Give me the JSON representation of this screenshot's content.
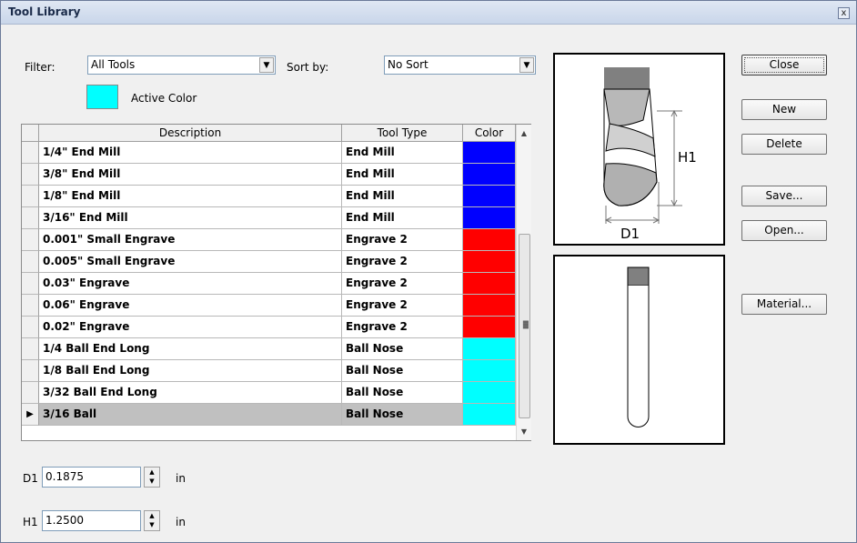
{
  "window": {
    "title": "Tool Library",
    "close_glyph": "x"
  },
  "filter": {
    "label": "Filter:",
    "value": "All Tools"
  },
  "sort": {
    "label": "Sort by:",
    "value": "No Sort"
  },
  "active_color": {
    "label": "Active Color",
    "color": "#00ffff"
  },
  "grid": {
    "columns": [
      "Description",
      "Tool Type",
      "Color"
    ],
    "rows": [
      {
        "description": "1/4\" End Mill",
        "type": "End Mill",
        "color": "#0000ff"
      },
      {
        "description": "3/8\" End Mill",
        "type": "End Mill",
        "color": "#0000ff"
      },
      {
        "description": "1/8\" End Mill",
        "type": "End Mill",
        "color": "#0000ff"
      },
      {
        "description": "3/16\" End Mill",
        "type": "End Mill",
        "color": "#0000ff"
      },
      {
        "description": "0.001\" Small Engrave",
        "type": "Engrave 2",
        "color": "#ff0000"
      },
      {
        "description": "0.005\" Small Engrave",
        "type": "Engrave 2",
        "color": "#ff0000"
      },
      {
        "description": "0.03\" Engrave",
        "type": "Engrave 2",
        "color": "#ff0000"
      },
      {
        "description": "0.06\" Engrave",
        "type": "Engrave 2",
        "color": "#ff0000"
      },
      {
        "description": "0.02\" Engrave",
        "type": "Engrave 2",
        "color": "#ff0000"
      },
      {
        "description": "1/4 Ball End Long",
        "type": "Ball Nose",
        "color": "#00ffff"
      },
      {
        "description": "1/8 Ball End Long",
        "type": "Ball Nose",
        "color": "#00ffff"
      },
      {
        "description": "3/32 Ball End Long",
        "type": "Ball Nose",
        "color": "#00ffff"
      },
      {
        "description": "3/16 Ball",
        "type": "Ball Nose",
        "color": "#00ffff",
        "selected": true
      }
    ]
  },
  "diagram": {
    "h_label": "H1",
    "d_label": "D1"
  },
  "buttons": {
    "close": "Close",
    "new": "New",
    "delete": "Delete",
    "save": "Save...",
    "open": "Open...",
    "material": "Material..."
  },
  "fields": {
    "d1": {
      "label": "D1",
      "value": "0.1875",
      "unit": "in"
    },
    "h1": {
      "label": "H1",
      "value": "1.2500",
      "unit": "in"
    }
  }
}
